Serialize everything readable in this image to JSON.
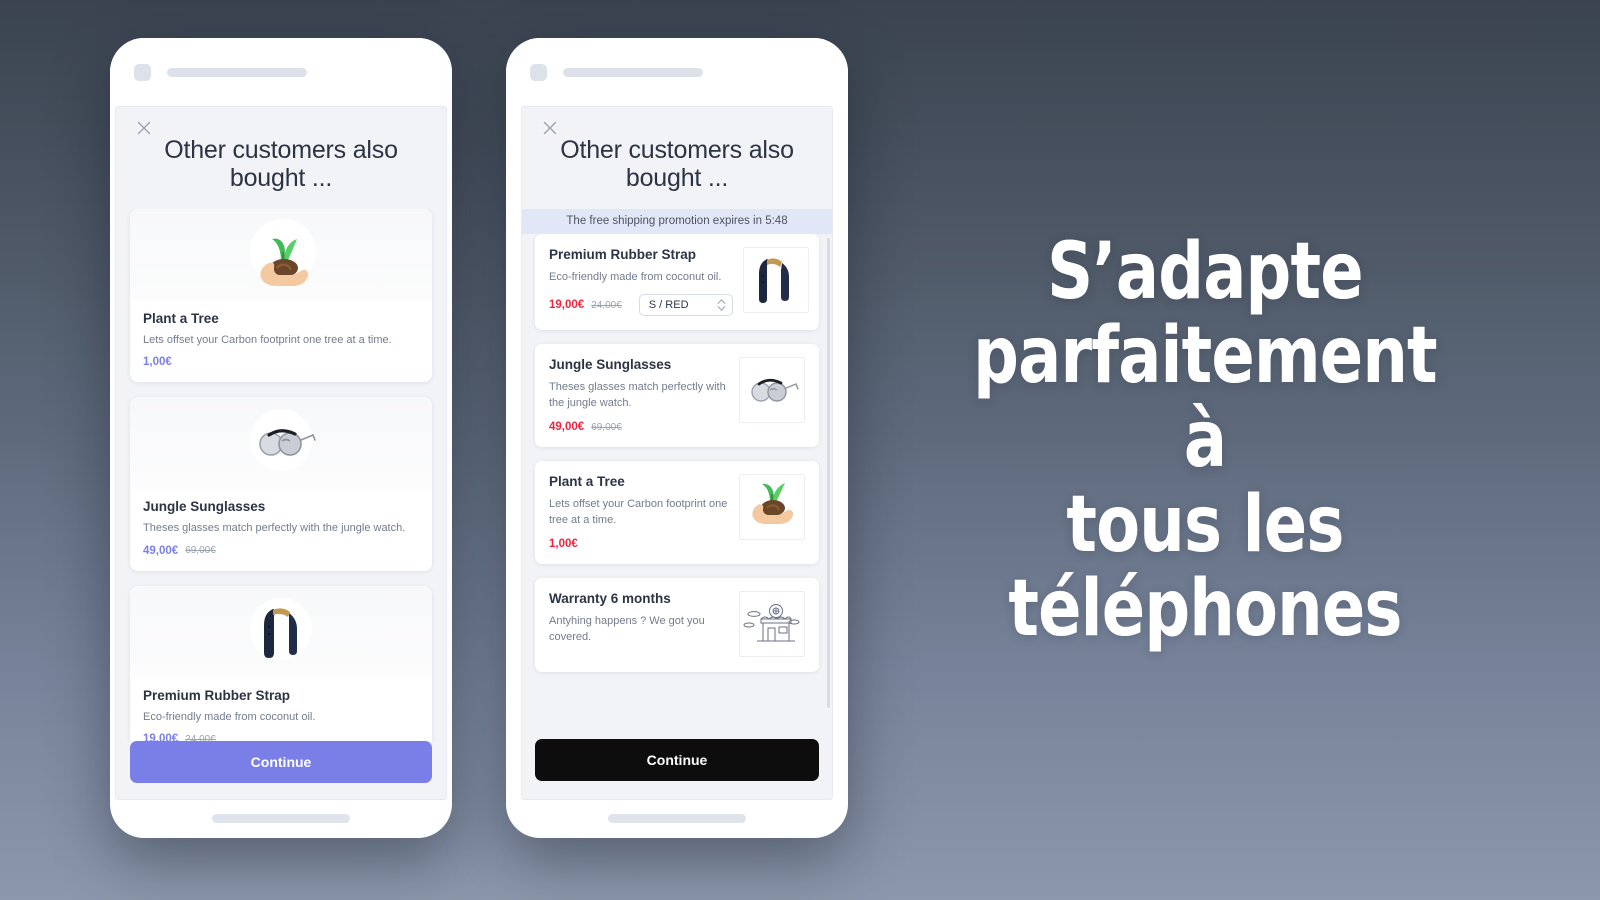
{
  "background": {
    "gradient_from": "#3b4350",
    "gradient_to": "#8c97ab"
  },
  "headline": {
    "lines": [
      "S’adapte",
      "parfaitement à",
      "tous les",
      "téléphones"
    ],
    "color": "#ffffff"
  },
  "phones": [
    {
      "id": "left",
      "variant": "stacked",
      "accent_color": "#7a7fe8",
      "topbar": {
        "square_icon": "app-logo-placeholder",
        "pill_label": ""
      },
      "modal": {
        "close_icon": "close-icon",
        "title": "Other customers also bought ...",
        "promo_banner": null,
        "products": [
          {
            "name": "Plant a Tree",
            "description": "Lets offset your Carbon footprint one tree at a time.",
            "price": "1,00€",
            "compare_at_price": "",
            "image": "seedling-in-hand-emoji",
            "variant_selector": null
          },
          {
            "name": "Jungle Sunglasses",
            "description": "Theses glasses match perfectly with the jungle watch.",
            "price": "49,00€",
            "compare_at_price": "69,00€",
            "image": "round-sunglasses-photo",
            "variant_selector": null
          },
          {
            "name": "Premium Rubber Strap",
            "description": "Eco-friendly made from coconut oil.",
            "price": "19,00€",
            "compare_at_price": "24,00€",
            "image": "navy-rubber-watch-strap-photo",
            "variant_selector": null
          }
        ],
        "continue_label": "Continue",
        "continue_style": "purple"
      }
    },
    {
      "id": "right",
      "variant": "row",
      "accent_color": "#f0263f",
      "topbar": {
        "square_icon": "app-logo-placeholder",
        "pill_label": ""
      },
      "modal": {
        "close_icon": "close-icon",
        "title": "Other customers also bought ...",
        "promo_banner": "The free shipping promotion expires in 5:48",
        "products": [
          {
            "name": "Premium Rubber Strap",
            "description": "Eco-friendly made from coconut oil.",
            "price": "19,00€",
            "compare_at_price": "24,00€",
            "image": "navy-rubber-watch-strap-photo",
            "variant_selector": "S / RED"
          },
          {
            "name": "Jungle Sunglasses",
            "description": "Theses glasses match perfectly with the jungle watch.",
            "price": "49,00€",
            "compare_at_price": "69,00€",
            "image": "round-sunglasses-photo",
            "variant_selector": null
          },
          {
            "name": "Plant a Tree",
            "description": "Lets offset your Carbon footprint one tree at a time.",
            "price": "1,00€",
            "compare_at_price": "",
            "image": "seedling-in-hand-emoji",
            "variant_selector": null
          },
          {
            "name": "Warranty 6 months",
            "description": "Antyhing happens ? We got you covered.",
            "price": "",
            "compare_at_price": "",
            "image": "storefront-line-illustration",
            "variant_selector": null
          }
        ],
        "continue_label": "Continue",
        "continue_style": "black"
      }
    }
  ]
}
